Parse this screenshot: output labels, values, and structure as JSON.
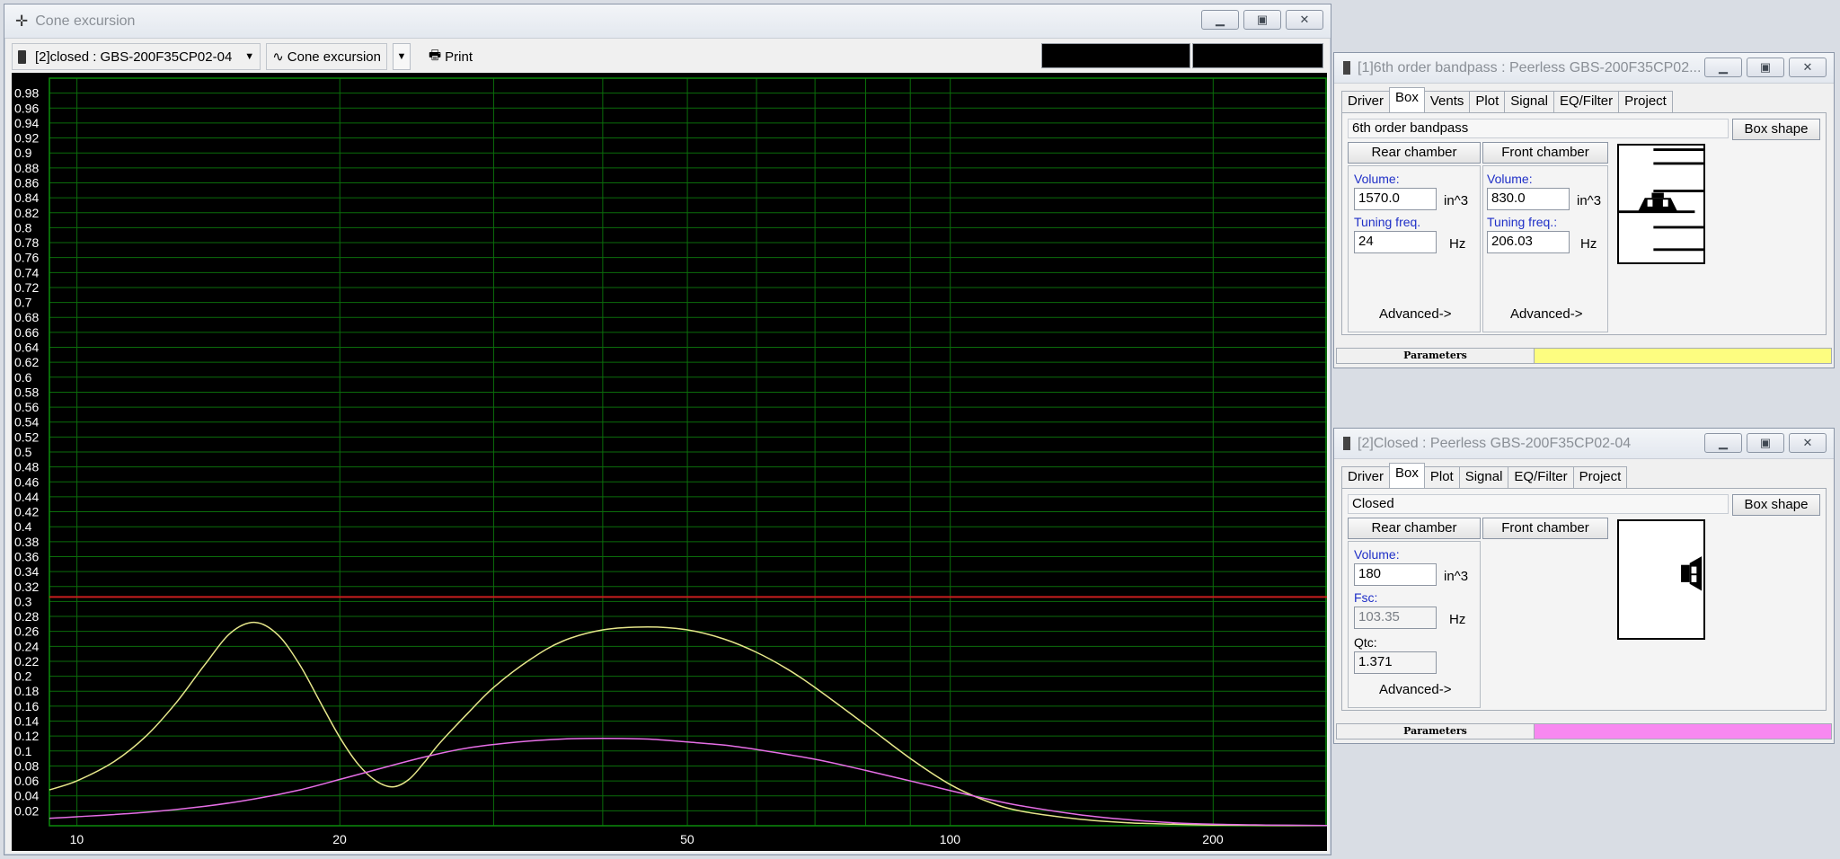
{
  "main_window": {
    "title": "Cone excursion",
    "project_select": "[2]closed : GBS-200F35CP02-04",
    "graph_select": "Cone excursion",
    "print_label": "Print",
    "icon": "target-icon"
  },
  "panel1": {
    "title": "[1]6th order bandpass : Peerless GBS-200F35CP02...",
    "tabs": [
      "Driver",
      "Box",
      "Vents",
      "Plot",
      "Signal",
      "EQ/Filter",
      "Project"
    ],
    "active_tab": "Box",
    "box_type": "6th order bandpass",
    "box_shape_button": "Box shape",
    "rear_chamber_label": "Rear chamber",
    "front_chamber_label": "Front chamber",
    "rear": {
      "volume_label": "Volume:",
      "volume": "1570.0",
      "volume_unit": "in^3",
      "tuning_label": "Tuning freq.",
      "tuning": "24",
      "tuning_unit": "Hz",
      "advanced": "Advanced->"
    },
    "front": {
      "volume_label": "Volume:",
      "volume": "830.0",
      "volume_unit": "in^3",
      "tuning_label": "Tuning freq.:",
      "tuning": "206.03",
      "tuning_unit": "Hz",
      "advanced": "Advanced->"
    },
    "status_label": "Parameters",
    "status_color": "#fdfd80"
  },
  "panel2": {
    "title": "[2]Closed : Peerless GBS-200F35CP02-04",
    "tabs": [
      "Driver",
      "Box",
      "Plot",
      "Signal",
      "EQ/Filter",
      "Project"
    ],
    "active_tab": "Box",
    "box_type": "Closed",
    "box_shape_button": "Box shape",
    "rear_chamber_label": "Rear chamber",
    "front_chamber_label": "Front chamber",
    "rear": {
      "volume_label": "Volume:",
      "volume": "180",
      "volume_unit": "in^3",
      "fsc_label": "Fsc:",
      "fsc": "103.35",
      "fsc_unit": "Hz",
      "qtc_label": "Qtc:",
      "qtc": "1.371",
      "advanced": "Advanced->"
    },
    "status_label": "Parameters",
    "status_color": "#f888f0"
  },
  "chart_data": {
    "type": "line",
    "x_scale": "log",
    "xlim": [
      9.3,
      270
    ],
    "ylim": [
      0,
      1.0
    ],
    "x_ticks": [
      10,
      20,
      50,
      100,
      200
    ],
    "y_ticks": [
      "0.98",
      "0.96",
      "0.94",
      "0.92",
      "0.9",
      "0.88",
      "0.86",
      "0.84",
      "0.82",
      "0.8",
      "0.78",
      "0.76",
      "0.74",
      "0.72",
      "0.7",
      "0.68",
      "0.66",
      "0.64",
      "0.62",
      "0.6",
      "0.58",
      "0.56",
      "0.54",
      "0.52",
      "0.5",
      "0.48",
      "0.46",
      "0.44",
      "0.42",
      "0.4",
      "0.38",
      "0.36",
      "0.34",
      "0.32",
      "0.3",
      "0.28",
      "0.26",
      "0.24",
      "0.22",
      "0.2",
      "0.18",
      "0.16",
      "0.14",
      "0.12",
      "0.1",
      "0.08",
      "0.06",
      "0.04",
      "0.02"
    ],
    "xmax_limit_line": 0.306,
    "grid": true,
    "colors": {
      "grid": "#0b6d0b",
      "limit_line": "#c81e1e",
      "bandpass": "#e6e68a",
      "closed": "#e66ee6"
    },
    "series": [
      {
        "x": [
          9.3,
          10,
          11,
          12,
          13,
          14,
          15,
          16,
          17,
          18,
          19,
          20,
          21,
          22,
          23,
          24,
          25,
          26,
          28,
          30,
          33,
          36,
          40,
          45,
          50,
          55,
          60,
          65,
          70,
          80,
          90,
          100,
          110,
          120,
          140,
          160,
          180,
          200,
          230,
          270
        ],
        "y": [
          0.048,
          0.06,
          0.085,
          0.12,
          0.165,
          0.215,
          0.258,
          0.272,
          0.255,
          0.215,
          0.165,
          0.118,
          0.082,
          0.06,
          0.052,
          0.062,
          0.085,
          0.11,
          0.15,
          0.185,
          0.222,
          0.247,
          0.262,
          0.266,
          0.262,
          0.25,
          0.232,
          0.21,
          0.185,
          0.135,
          0.09,
          0.055,
          0.033,
          0.02,
          0.009,
          0.004,
          0.002,
          0.001,
          0.0005,
          0.0002
        ]
      },
      {
        "x": [
          9.3,
          10,
          12,
          14,
          16,
          18,
          20,
          22,
          25,
          28,
          32,
          36,
          40,
          45,
          50,
          55,
          60,
          70,
          80,
          90,
          100,
          110,
          120,
          140,
          160,
          180,
          200,
          230,
          270
        ],
        "y": [
          0.01,
          0.012,
          0.018,
          0.026,
          0.036,
          0.048,
          0.062,
          0.075,
          0.092,
          0.104,
          0.112,
          0.116,
          0.117,
          0.116,
          0.112,
          0.108,
          0.102,
          0.089,
          0.074,
          0.06,
          0.047,
          0.036,
          0.027,
          0.015,
          0.008,
          0.004,
          0.002,
          0.001,
          0.0004
        ]
      }
    ]
  }
}
